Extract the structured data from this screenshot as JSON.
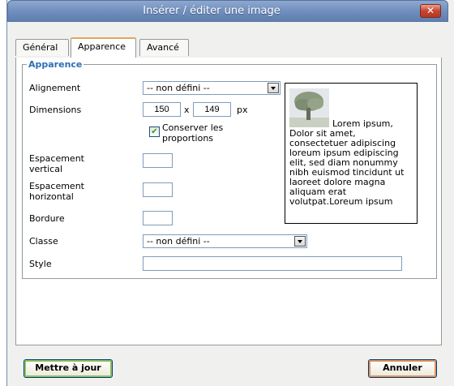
{
  "window": {
    "title": "Insérer / éditer une image",
    "close_label": "✕"
  },
  "tabs": [
    {
      "label": "Général",
      "active": false
    },
    {
      "label": "Apparence",
      "active": true
    },
    {
      "label": "Avancé",
      "active": false
    }
  ],
  "fieldset": {
    "legend": "Apparence"
  },
  "form": {
    "alignment_label": "Alignement",
    "alignment_value": "-- non défini --",
    "dimensions_label": "Dimensions",
    "width_value": "150",
    "times": "x",
    "height_value": "149",
    "unit": "px",
    "keep_proportions_label": "Conserver les proportions",
    "keep_proportions_checked": true,
    "vspace_label": "Espacement vertical",
    "vspace_value": "",
    "hspace_label": "Espacement horizontal",
    "hspace_value": "",
    "border_label": "Bordure",
    "border_value": "",
    "class_label": "Classe",
    "class_value": "-- non défini --",
    "style_label": "Style",
    "style_value": ""
  },
  "preview": {
    "text": "Lorem ipsum, Dolor sit amet, consectetuer adipiscing loreum ipsum edipiscing elit, sed diam nonummy nibh euismod tincidunt ut laoreet dolore magna aliquam erat volutpat.Loreum ipsum"
  },
  "buttons": {
    "update": "Mettre à jour",
    "cancel": "Annuler"
  },
  "colors": {
    "legend": "#2b6fb6",
    "titlebar": "#6f8dbb",
    "active_tab_accent": "#e0a95a"
  }
}
